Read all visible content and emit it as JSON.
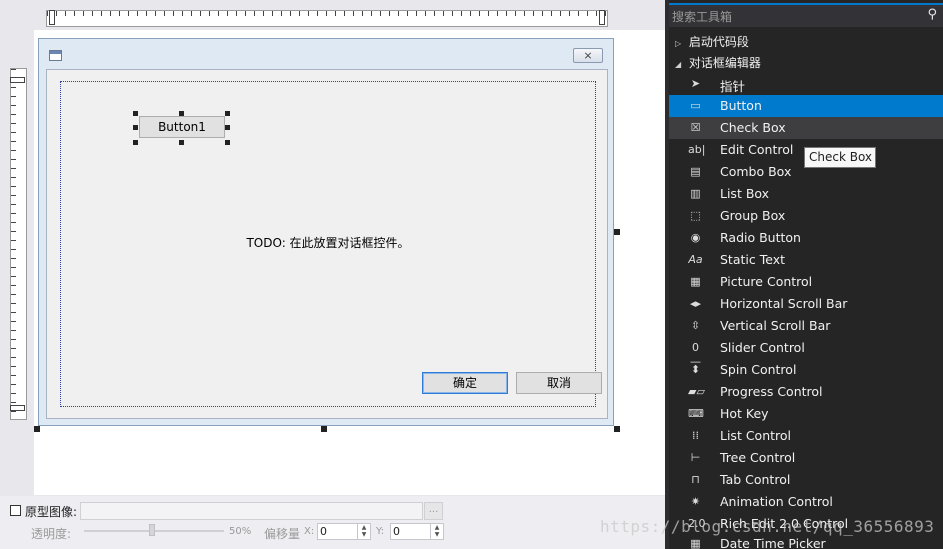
{
  "designer": {
    "dialog": {
      "close_glyph": "⨯",
      "button1_label": "Button1",
      "todo_text": "TODO: 在此放置对话框控件。",
      "ok_label": "确定",
      "cancel_label": "取消"
    }
  },
  "bottom_bar": {
    "prototype_checkbox_checked": false,
    "prototype_label": "原型图像:",
    "prototype_path": "",
    "browse_label": "...",
    "opacity_label": "透明度:",
    "opacity_percent": 50,
    "opacity_value_text": "50%",
    "offset_label": "偏移量",
    "x_label": "X:",
    "x_value": "0",
    "y_label": "Y:",
    "y_value": "0"
  },
  "toolbox": {
    "search_placeholder": "搜索工具箱",
    "groups": [
      {
        "label": "启动代码段",
        "expanded": false
      },
      {
        "label": "对话框编辑器",
        "expanded": true
      }
    ],
    "items": [
      {
        "label": "指针",
        "icon": "pointer-icon"
      },
      {
        "label": "Button",
        "icon": "button-icon",
        "state": "selected"
      },
      {
        "label": "Check Box",
        "icon": "checkbox-icon",
        "state": "hover"
      },
      {
        "label": "Edit Control",
        "icon": "edit-control-icon"
      },
      {
        "label": "Combo Box",
        "icon": "combo-box-icon"
      },
      {
        "label": "List Box",
        "icon": "list-box-icon"
      },
      {
        "label": "Group Box",
        "icon": "group-box-icon"
      },
      {
        "label": "Radio Button",
        "icon": "radio-button-icon"
      },
      {
        "label": "Static Text",
        "icon": "static-text-icon"
      },
      {
        "label": "Picture Control",
        "icon": "picture-control-icon"
      },
      {
        "label": "Horizontal Scroll Bar",
        "icon": "hscroll-icon"
      },
      {
        "label": "Vertical Scroll Bar",
        "icon": "vscroll-icon"
      },
      {
        "label": "Slider Control",
        "icon": "slider-icon"
      },
      {
        "label": "Spin Control",
        "icon": "spin-icon"
      },
      {
        "label": "Progress Control",
        "icon": "progress-icon"
      },
      {
        "label": "Hot Key",
        "icon": "hotkey-icon"
      },
      {
        "label": "List Control",
        "icon": "list-control-icon"
      },
      {
        "label": "Tree Control",
        "icon": "tree-control-icon"
      },
      {
        "label": "Tab Control",
        "icon": "tab-control-icon"
      },
      {
        "label": "Animation Control",
        "icon": "animation-icon"
      },
      {
        "label": "Rich Edit 2.0 Control",
        "icon": "rich-edit-icon"
      },
      {
        "label": "Date Time Picker",
        "icon": "datetime-icon"
      }
    ],
    "tooltip": "Check Box"
  },
  "watermark": "https://blog.csdn.net/qq_36556893",
  "colors": {
    "toolbox_bg": "#252526",
    "selection": "#007acc",
    "hover": "#3e3e40",
    "dialog_client": "#f0f0f0"
  }
}
